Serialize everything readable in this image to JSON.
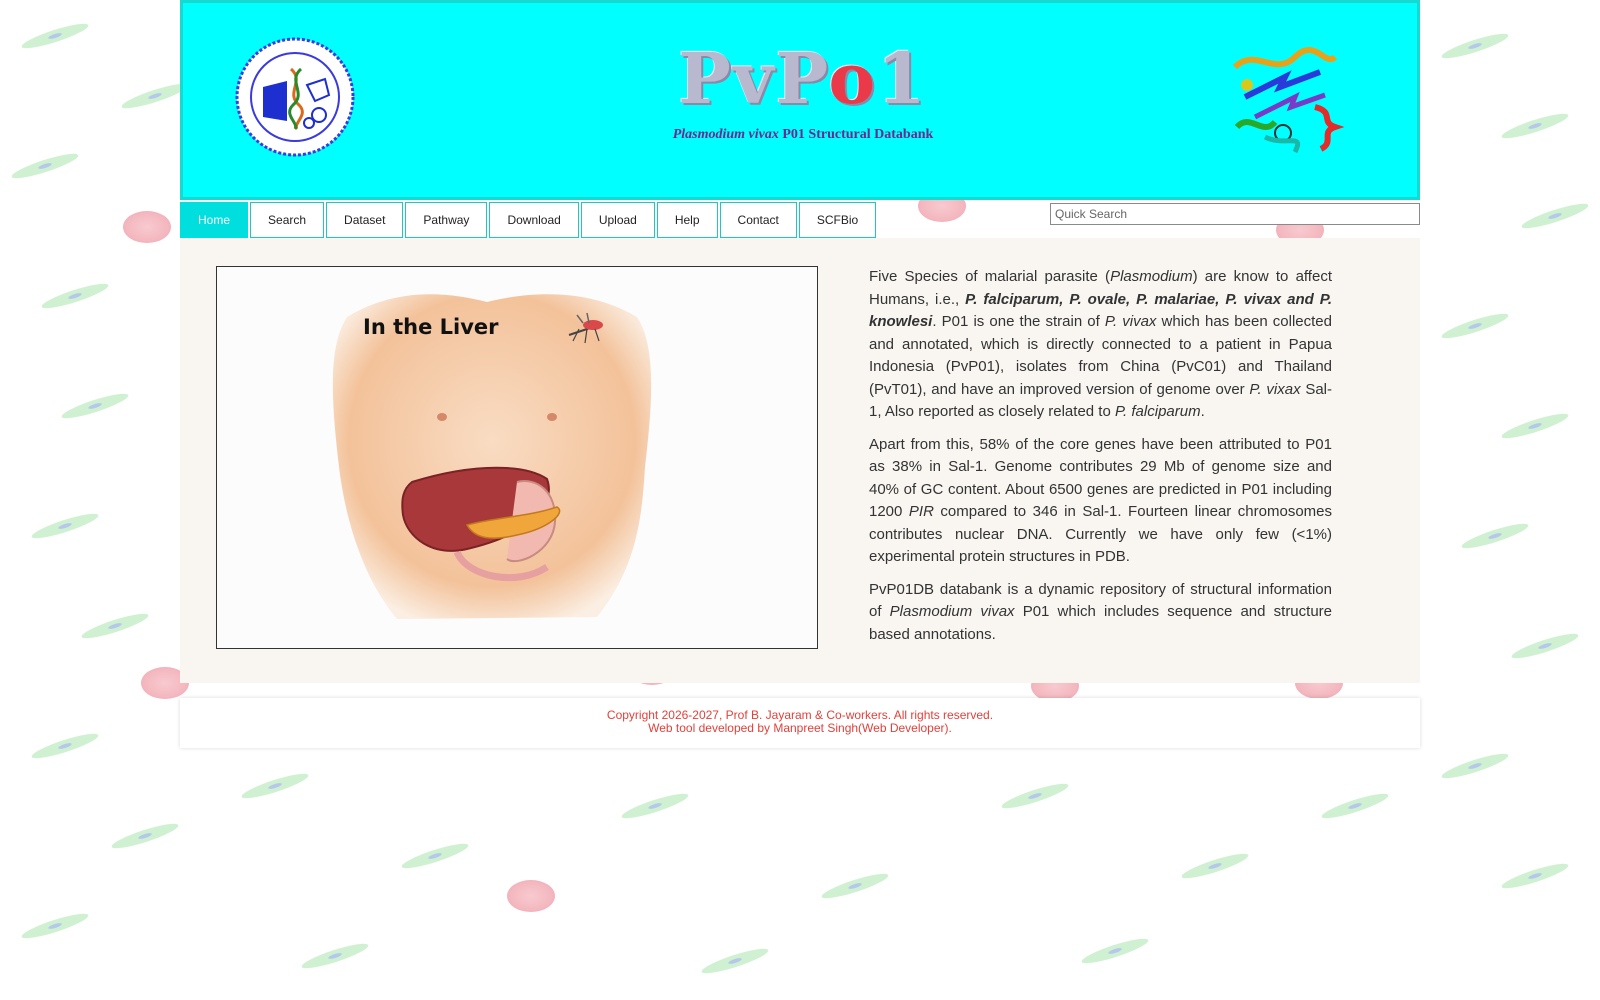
{
  "header": {
    "subtitle_italic": "Plasmodium vivax",
    "subtitle_rest": " P01 Structural Databank"
  },
  "nav": {
    "items": [
      {
        "label": "Home"
      },
      {
        "label": "Search"
      },
      {
        "label": "Dataset"
      },
      {
        "label": "Pathway"
      },
      {
        "label": "Download"
      },
      {
        "label": "Upload"
      },
      {
        "label": "Help"
      },
      {
        "label": "Contact"
      },
      {
        "label": "SCFBio"
      }
    ],
    "search_placeholder": "Quick Search"
  },
  "main": {
    "image_caption": "In the Liver",
    "para1": {
      "a": "Five Species of malarial parasite (",
      "b_italic": "Plasmodium",
      "c": ") are know to affect Humans, i.e., ",
      "d_bold_italic": "P. falciparum, P. ovale, P. malariae, P. vivax and P. knowlesi",
      "e": ". P01 is one the strain of ",
      "f_italic": "P. vivax",
      "g": " which has been collected and annotated, which is directly connected to a patient in Papua Indonesia (PvP01), isolates from China (PvC01) and Thailand (PvT01), and have an improved version of genome over ",
      "h_italic": "P. vixax",
      "i": " Sal-1, Also reported as closely related to ",
      "j_italic": "P. falciparum",
      "k": "."
    },
    "para2": {
      "a": "Apart from this, 58% of the core genes have been attributed to P01 as 38% in Sal-1. Genome contributes 29 Mb of genome size and 40% of GC content. About 6500 genes are predicted in P01 including 1200 ",
      "b_italic": "PIR",
      "c": " compared to 346 in Sal-1. Fourteen linear chromosomes contributes nuclear DNA. Currently we have only few (<1%) experimental protein structures in PDB."
    },
    "para3": {
      "a": "PvP01DB databank is a dynamic repository of structural information of ",
      "b_italic": "Plasmodium vivax",
      "c": " P01 which includes sequence and structure based annotations."
    }
  },
  "footer": {
    "line1": "Copyright 2026-2027, Prof B. Jayaram & Co-workers. All rights reserved.",
    "line2": "Web tool developed by Manpreet Singh(Web Developer)."
  },
  "colors": {
    "header_bg": "#00ffff",
    "nav_active": "#00dede",
    "footer_text": "#e2413b",
    "content_bg": "#f9f6f2"
  }
}
